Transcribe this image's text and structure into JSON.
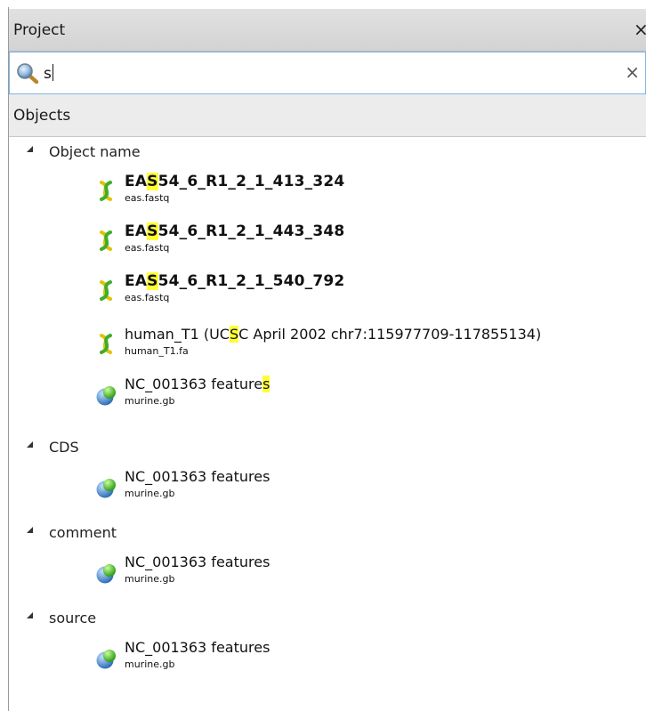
{
  "panel": {
    "title": "Project",
    "close_glyph": "×"
  },
  "search": {
    "value": "s",
    "icon": "search-magnifier-icon",
    "clear_glyph": "×"
  },
  "section": {
    "title": "Objects"
  },
  "highlight_color": "#ffff33",
  "groups": [
    {
      "label": "Object name",
      "items": [
        {
          "pre": "EA",
          "hl": "S",
          "post": "54_6_R1_2_1_413_324",
          "file": "eas.fastq",
          "icon": "sequence-icon",
          "bold": true
        },
        {
          "pre": "EA",
          "hl": "S",
          "post": "54_6_R1_2_1_443_348",
          "file": "eas.fastq",
          "icon": "sequence-icon",
          "bold": true
        },
        {
          "pre": "EA",
          "hl": "S",
          "post": "54_6_R1_2_1_540_792",
          "file": "eas.fastq",
          "icon": "sequence-icon",
          "bold": true
        },
        {
          "pre": "human_T1 (UC",
          "hl": "S",
          "post": "C April 2002 chr7:115977709-117855134)",
          "file": "human_T1.fa",
          "icon": "sequence-icon",
          "bold": false
        },
        {
          "pre": "NC_001363 feature",
          "hl": "s",
          "post": "",
          "file": "murine.gb",
          "icon": "annotation-table-icon",
          "bold": false
        }
      ]
    },
    {
      "label": "CDS",
      "items": [
        {
          "pre": "NC_001363 features",
          "hl": "",
          "post": "",
          "file": "murine.gb",
          "icon": "annotation-table-icon",
          "bold": false
        }
      ]
    },
    {
      "label": "comment",
      "items": [
        {
          "pre": "NC_001363 features",
          "hl": "",
          "post": "",
          "file": "murine.gb",
          "icon": "annotation-table-icon",
          "bold": false
        }
      ]
    },
    {
      "label": "source",
      "items": [
        {
          "pre": "NC_001363 features",
          "hl": "",
          "post": "",
          "file": "murine.gb",
          "icon": "annotation-table-icon",
          "bold": false
        }
      ]
    }
  ]
}
